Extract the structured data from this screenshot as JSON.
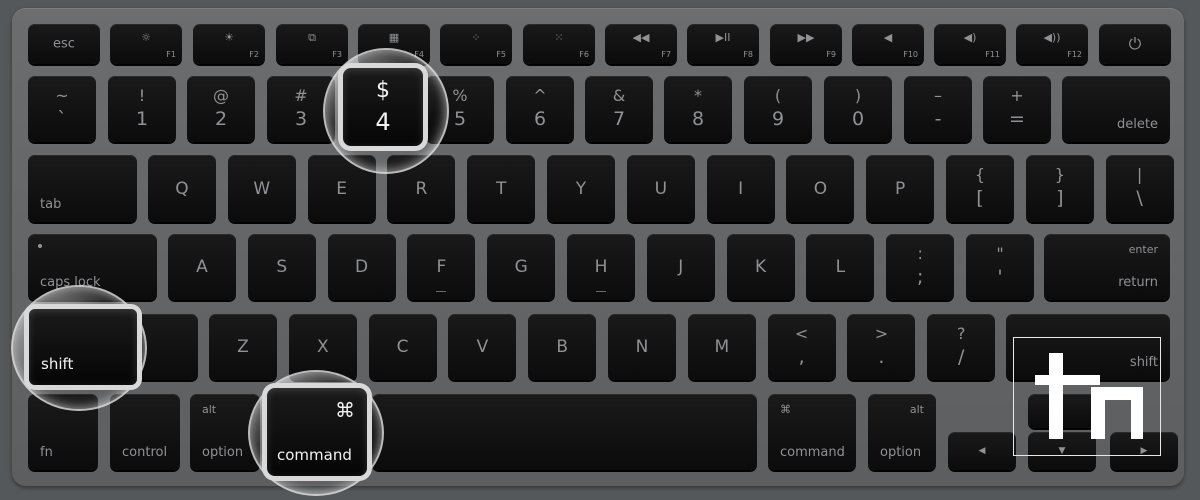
{
  "scene": "Apple aluminum keyboard with magnifier lenses highlighting keys",
  "function_row": [
    {
      "label": "esc"
    },
    {
      "label": "F1",
      "icon": "brightness-down-icon",
      "glyph": "☼"
    },
    {
      "label": "F2",
      "icon": "brightness-up-icon",
      "glyph": "☀"
    },
    {
      "label": "F3",
      "icon": "expose-icon",
      "glyph": "⧉"
    },
    {
      "label": "F4",
      "icon": "dashboard-icon",
      "glyph": "▦"
    },
    {
      "label": "F5",
      "icon": "keyboard-light-down-icon",
      "glyph": "⁘"
    },
    {
      "label": "F6",
      "icon": "keyboard-light-up-icon",
      "glyph": "⁙"
    },
    {
      "label": "F7",
      "icon": "rewind-icon",
      "glyph": "◀◀"
    },
    {
      "label": "F8",
      "icon": "play-pause-icon",
      "glyph": "▶II"
    },
    {
      "label": "F9",
      "icon": "fast-forward-icon",
      "glyph": "▶▶"
    },
    {
      "label": "F10",
      "icon": "mute-icon",
      "glyph": "◀"
    },
    {
      "label": "F11",
      "icon": "volume-down-icon",
      "glyph": "◀)"
    },
    {
      "label": "F12",
      "icon": "volume-up-icon",
      "glyph": "◀))"
    },
    {
      "label": "",
      "icon": "power-icon",
      "glyph": "⏻"
    }
  ],
  "number_row": [
    {
      "top": "~",
      "bottom": "`"
    },
    {
      "top": "!",
      "bottom": "1"
    },
    {
      "top": "@",
      "bottom": "2"
    },
    {
      "top": "#",
      "bottom": "3"
    },
    {
      "top": "$",
      "bottom": "4"
    },
    {
      "top": "%",
      "bottom": "5"
    },
    {
      "top": "^",
      "bottom": "6"
    },
    {
      "top": "&",
      "bottom": "7"
    },
    {
      "top": "*",
      "bottom": "8"
    },
    {
      "top": "(",
      "bottom": "9"
    },
    {
      "top": ")",
      "bottom": "0"
    },
    {
      "top": "–",
      "bottom": "-"
    },
    {
      "top": "+",
      "bottom": "="
    },
    {
      "word": "delete"
    }
  ],
  "qwerty_row": [
    {
      "word": "tab"
    },
    {
      "single": "Q"
    },
    {
      "single": "W"
    },
    {
      "single": "E"
    },
    {
      "single": "R"
    },
    {
      "single": "T"
    },
    {
      "single": "Y"
    },
    {
      "single": "U"
    },
    {
      "single": "I"
    },
    {
      "single": "O"
    },
    {
      "single": "P"
    },
    {
      "top": "{",
      "bottom": "["
    },
    {
      "top": "}",
      "bottom": "]"
    },
    {
      "top": "|",
      "bottom": "\\"
    }
  ],
  "home_row": [
    {
      "word": "caps lock"
    },
    {
      "single": "A"
    },
    {
      "single": "S"
    },
    {
      "single": "D"
    },
    {
      "single": "F"
    },
    {
      "single": "G"
    },
    {
      "single": "H"
    },
    {
      "single": "J"
    },
    {
      "single": "K"
    },
    {
      "single": "L"
    },
    {
      "top": ":",
      "bottom": ";"
    },
    {
      "top": "\"",
      "bottom": "'"
    },
    {
      "small": "enter",
      "word": "return"
    }
  ],
  "shift_row": [
    {
      "word": "shift"
    },
    {
      "single": "Z"
    },
    {
      "single": "X"
    },
    {
      "single": "C"
    },
    {
      "single": "V"
    },
    {
      "single": "B"
    },
    {
      "single": "N"
    },
    {
      "single": "M"
    },
    {
      "top": "<",
      "bottom": ","
    },
    {
      "top": ">",
      "bottom": "."
    },
    {
      "top": "?",
      "bottom": "/"
    },
    {
      "word": "shift"
    }
  ],
  "bottom_row": [
    {
      "word": "fn"
    },
    {
      "word": "control"
    },
    {
      "small": "alt",
      "word": "option"
    },
    {
      "small": "⌘",
      "word": "command"
    },
    {
      "word": ""
    },
    {
      "small": "⌘",
      "word": "command"
    },
    {
      "small": "alt",
      "word": "option"
    }
  ],
  "arrows": {
    "left": "◀",
    "down": "▼",
    "right": "▶"
  },
  "lenses": {
    "dollar_key": {
      "top": "$",
      "bottom": "4"
    },
    "shift_key": {
      "word": "shift"
    },
    "command_key": {
      "symbol": "⌘",
      "word": "command"
    }
  },
  "colors": {
    "key": "#0b0b0c",
    "legend": "#8f9193",
    "deck": "#626466",
    "lens_ring": "#d9d9d9",
    "logo": "#ffffff"
  }
}
